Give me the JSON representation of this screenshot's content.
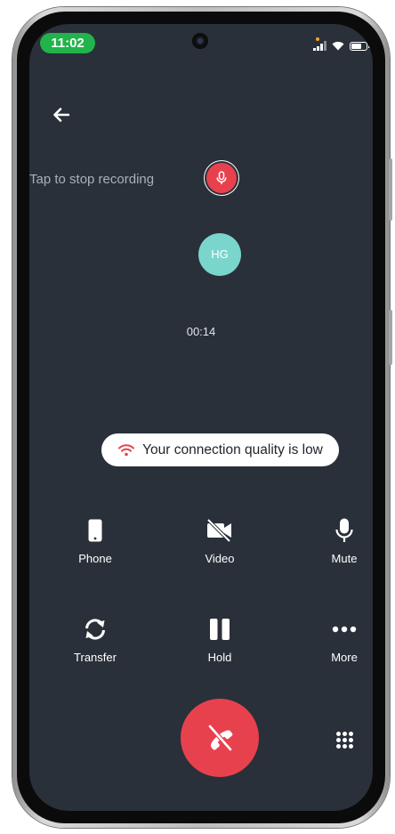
{
  "status_bar": {
    "time": "11:02"
  },
  "recording": {
    "label": "Tap to stop recording"
  },
  "contact": {
    "initials": "HG"
  },
  "call": {
    "duration": "00:14"
  },
  "alert": {
    "message": "Your connection quality is low"
  },
  "actions": [
    {
      "label": "Phone",
      "icon": "phone-icon"
    },
    {
      "label": "Video",
      "icon": "video-off-icon"
    },
    {
      "label": "Mute",
      "icon": "microphone-icon"
    },
    {
      "label": "Transfer",
      "icon": "transfer-icon"
    },
    {
      "label": "Hold",
      "icon": "pause-icon"
    },
    {
      "label": "More",
      "icon": "more-icon"
    }
  ],
  "colors": {
    "screen_bg": "#293039",
    "end_call": "#e8414e",
    "avatar": "#7ad6cc",
    "time_pill": "#22b34a"
  }
}
